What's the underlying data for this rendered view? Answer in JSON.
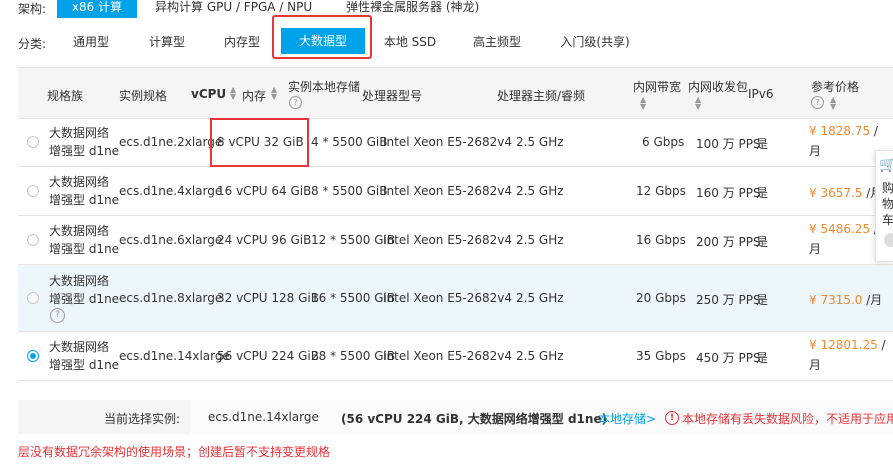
{
  "arch": {
    "label": "架构:",
    "options": [
      {
        "label": "x86 计算",
        "active": true
      },
      {
        "label": "异构计算 GPU / FPGA / NPU",
        "active": false
      },
      {
        "label": "弹性裸金属服务器 (神龙)",
        "active": false
      }
    ]
  },
  "category": {
    "label": "分类:",
    "options": [
      {
        "label": "通用型",
        "active": false
      },
      {
        "label": "计算型",
        "active": false
      },
      {
        "label": "内存型",
        "active": false
      },
      {
        "label": "大数据型",
        "active": true
      },
      {
        "label": "本地 SSD",
        "active": false
      },
      {
        "label": "高主频型",
        "active": false
      },
      {
        "label": "入门级(共享)",
        "active": false
      }
    ]
  },
  "table": {
    "headers": {
      "family": "规格族",
      "spec": "实例规格",
      "vcpu": "vCPU",
      "mem": "内存",
      "storage": "实例本地存储",
      "cpu_model": "处理器型号",
      "freq": "处理器主频/睿频",
      "bandwidth": "内网带宽",
      "pps": "内网收发包",
      "ipv6": "IPv6",
      "price": "参考价格"
    },
    "rows": [
      {
        "family1": "大数据网络",
        "family2": "增强型 d1ne",
        "spec": "ecs.d1ne.2xlarge",
        "vcpu_mem": "8 vCPU   32 GiB",
        "storage": "4 * 5500 GiB",
        "cpu": "Intel Xeon E5-2682v4",
        "freq": "2.5 GHz",
        "bw": "6 Gbps",
        "pps": "100 万 PPS",
        "ipv6": "是",
        "price": "¥ 1828.75",
        "unit1": " /",
        "unit2": "月",
        "checked": false
      },
      {
        "family1": "大数据网络",
        "family2": "增强型 d1ne",
        "spec": "ecs.d1ne.4xlarge",
        "vcpu_mem": "16 vCPU 64 GiB",
        "storage": "8 * 5500 GiB",
        "cpu": "Intel Xeon E5-2682v4",
        "freq": "2.5 GHz",
        "bw": "12 Gbps",
        "pps": "160 万 PPS",
        "ipv6": "是",
        "price": "¥ 3657.5",
        "unit1": " /月",
        "unit2": "",
        "checked": false
      },
      {
        "family1": "大数据网络",
        "family2": "增强型 d1ne",
        "spec": "ecs.d1ne.6xlarge",
        "vcpu_mem": "24 vCPU 96 GiB",
        "storage": "12 * 5500 GiB",
        "cpu": "Intel Xeon E5-2682v4",
        "freq": "2.5 GHz",
        "bw": "16 Gbps",
        "pps": "200 万 PPS",
        "ipv6": "是",
        "price": "¥ 5486.25",
        "unit1": " /",
        "unit2": "月",
        "checked": false
      },
      {
        "family1": "大数据网络",
        "family2": "增强型 d1ne",
        "spec": "ecs.d1ne.8xlarge",
        "vcpu_mem": "32 vCPU 128 GiB",
        "storage": "16 * 5500 GiB",
        "cpu": "Intel Xeon E5-2682v4",
        "freq": "2.5 GHz",
        "bw": "20 Gbps",
        "pps": "250 万 PPS",
        "ipv6": "是",
        "price": "¥ 7315.0",
        "unit1": " /月",
        "unit2": "",
        "checked": false
      },
      {
        "family1": "大数据网络",
        "family2": "增强型 d1ne",
        "spec": "ecs.d1ne.14xlarge",
        "vcpu_mem": "56 vCPU 224 GiB",
        "storage": "28 * 5500 GiB",
        "cpu": "Intel Xeon E5-2682v4",
        "freq": "2.5 GHz",
        "bw": "35 Gbps",
        "pps": "450 万 PPS",
        "ipv6": "是",
        "price": "¥ 12801.25",
        "unit1": " /",
        "unit2": "月",
        "checked": true
      }
    ]
  },
  "summary": {
    "label": "当前选择实例:",
    "instance": "ecs.d1ne.14xlarge",
    "detail": "(56 vCPU 224 GiB, 大数据网络增强型 d1ne)",
    "storage_link": "本地存储>",
    "warning": "本地存储有丢失数据风险，不适用于应用"
  },
  "footer_note": "层没有数据冗余架构的使用场景；创建后暂不支持变更规格",
  "side_widget": {
    "line1": "购",
    "line2": "物",
    "line3": "车"
  },
  "colors": {
    "accent": "#00a3ea",
    "price": "#f0882d",
    "warning": "#e8343a"
  }
}
